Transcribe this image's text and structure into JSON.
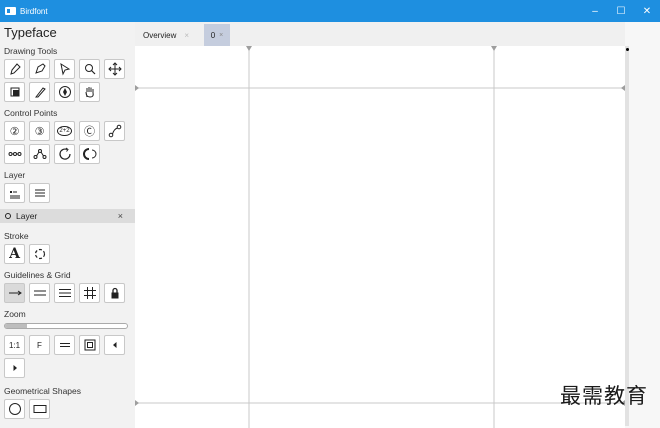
{
  "window": {
    "title": "Birdfont",
    "minimize": "–",
    "maximize": "☐",
    "close": "✕"
  },
  "panel": {
    "title": "Typeface",
    "drawing_tools_label": "Drawing Tools",
    "control_points_label": "Control Points",
    "control_points_row1": [
      "②",
      "③",
      "2+2",
      "Ⓒ"
    ],
    "layer_label": "Layer",
    "layer_item": {
      "label": "Layer",
      "close": "×"
    },
    "stroke_label": "Stroke",
    "stroke_tools": [
      "A"
    ],
    "guidelines_label": "Guidelines & Grid",
    "zoom_label": "Zoom",
    "zoom_level": 0.18,
    "zoom_tools": [
      "1:1",
      "F"
    ],
    "geometric_label": "Geometrical Shapes"
  },
  "tabs": [
    {
      "label": "Overview",
      "close": "×"
    },
    {
      "label": "0",
      "close": "×"
    }
  ],
  "watermark": "最需教育",
  "colors": {
    "titlebar": "#1e8fe0",
    "active_tab": "#c5cdde",
    "guide": "#c8c8c8"
  }
}
